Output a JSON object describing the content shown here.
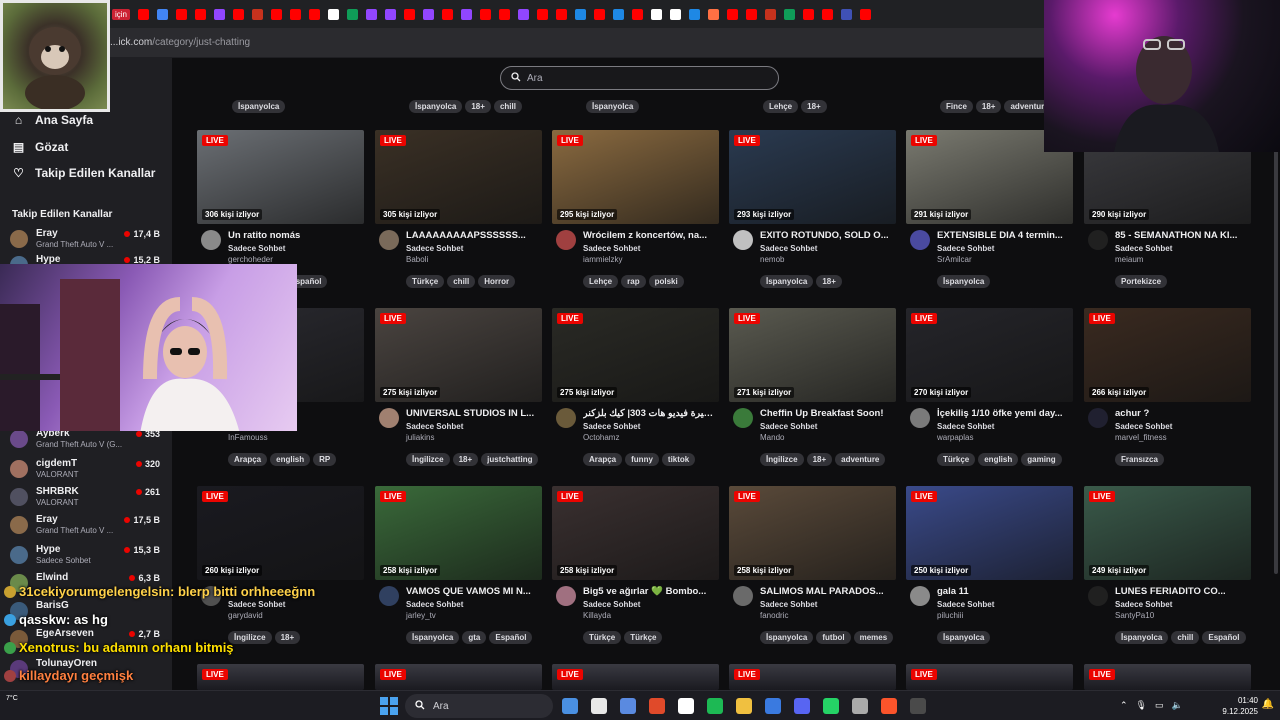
{
  "browser": {
    "url_prefix": "...ick.com",
    "url_path": "/category/just-chatting",
    "bookmark_label": "için",
    "bookmark_colors": [
      "#ff0000",
      "#4285f4",
      "#ff0000",
      "#ff0000",
      "#9146ff",
      "#ff0000",
      "#c7321d",
      "#ff0000",
      "#ff0000",
      "#ff0000",
      "#ffffff",
      "#0f9d58",
      "#9146ff",
      "#9146ff",
      "#ff0000",
      "#9146ff",
      "#ff0000",
      "#9146ff",
      "#ff0000",
      "#ff0000",
      "#9146ff",
      "#ff0000",
      "#ff0000",
      "#1e88e5",
      "#ff0000",
      "#1e88e5",
      "#ff0000",
      "#ffffff",
      "#ffffff",
      "#1e88e5",
      "#ff7043",
      "#ff0000",
      "#ff0000",
      "#c7321d",
      "#0f9d58",
      "#ff0000",
      "#ff0000",
      "#3f51b5",
      "#ff0000"
    ]
  },
  "sidebar": {
    "nav": [
      {
        "label": "Ana Sayfa",
        "icon": "home-icon",
        "glyph": "⌂"
      },
      {
        "label": "Gözat",
        "icon": "browse-icon",
        "glyph": "▤"
      },
      {
        "label": "Takip Edilen Kanallar",
        "icon": "heart-icon",
        "glyph": "♡"
      }
    ],
    "followed_heading": "Takip Edilen Kanallar",
    "channels": [
      {
        "name": "Eray",
        "game": "Grand Theft Auto V ...",
        "viewers": "17,4 B",
        "color": "#8a6a4a"
      },
      {
        "name": "Hype",
        "game": "",
        "viewers": "15,2 B",
        "color": "#4a6a8a"
      },
      {
        "name": "Ayberk",
        "game": "Grand Theft Auto V (G...",
        "viewers": "353",
        "color": "#6a4a8a"
      },
      {
        "name": "cigdemT",
        "game": "VALORANT",
        "viewers": "320",
        "color": "#a07060"
      },
      {
        "name": "SHRBRK",
        "game": "VALORANT",
        "viewers": "261",
        "color": "#505060"
      },
      {
        "name": "Eray",
        "game": "Grand Theft Auto V ...",
        "viewers": "17,5 B",
        "color": "#8a6a4a"
      },
      {
        "name": "Hype",
        "game": "Sadece Sohbet",
        "viewers": "15,3 B",
        "color": "#4a6a8a"
      },
      {
        "name": "Elwind",
        "game": "",
        "viewers": "6,3 B",
        "color": "#6a8a4a"
      },
      {
        "name": "BarisG",
        "game": "",
        "viewers": "",
        "color": "#3a5a7a"
      },
      {
        "name": "EgeArseven",
        "game": "",
        "viewers": "2,7 B",
        "color": "#7a5a3a"
      },
      {
        "name": "TolunayOren",
        "game": "",
        "viewers": "",
        "color": "#5a3a7a"
      }
    ]
  },
  "search": {
    "placeholder": "Ara"
  },
  "top_tag_rows": [
    [
      "İspanyolca"
    ],
    [
      "İspanyolca",
      "18+",
      "chill"
    ],
    [
      "İspanyolca"
    ],
    [
      "Lehçe",
      "18+"
    ],
    [
      "Fince",
      "18+",
      "adventure"
    ]
  ],
  "cards": [
    {
      "viewers": "306 kişi izliyor",
      "title": "Un ratito nomás",
      "category": "Sadece Sohbet",
      "channel": "gerchoheder",
      "tags": [
        "İspanyolca",
        "Español"
      ],
      "thumb": "#6b6f74",
      "avatar": "#8a8a8a"
    },
    {
      "viewers": "305 kişi izliyor",
      "title": "LAAAAAAAAAPSSSSSS...",
      "category": "Sadece Sohbet",
      "channel": "Baboli",
      "tags": [
        "Türkçe",
        "chill",
        "Horror"
      ],
      "thumb": "#3a3025",
      "avatar": "#7a6a5a"
    },
    {
      "viewers": "295 kişi izliyor",
      "title": "Wrócilem z koncertów, na...",
      "category": "Sadece Sohbet",
      "channel": "iammielzky",
      "tags": [
        "Lehçe",
        "rap",
        "polski"
      ],
      "thumb": "#8a6a40",
      "avatar": "#a04040"
    },
    {
      "viewers": "293 kişi izliyor",
      "title": "EXITO ROTUNDO, SOLD O...",
      "category": "Sadece Sohbet",
      "channel": "nemob",
      "tags": [
        "İspanyolca",
        "18+"
      ],
      "thumb": "#2a3a50",
      "avatar": "#c0c0c0"
    },
    {
      "viewers": "291 kişi izliyor",
      "title": "EXTENSIBLE DIA 4 termin...",
      "category": "Sadece Sohbet",
      "channel": "SrAmilcar",
      "tags": [
        "İspanyolca"
      ],
      "thumb": "#7a7a70",
      "avatar": "#4a4aa0"
    },
    {
      "viewers": "290 kişi izliyor",
      "title": "85 - SEMANATHON NA KI...",
      "category": "Sadece Sohbet",
      "channel": "meiaum",
      "tags": [
        "Portekizce"
      ],
      "thumb": "#3a3a3e",
      "avatar": "#202020"
    },
    {
      "viewers": "",
      "title": "Zero Noise.",
      "category": "",
      "channel": "InFamouss",
      "tags": [
        "Arapça",
        "english",
        "RP"
      ],
      "thumb": "#2a2a30",
      "avatar": "#404040"
    },
    {
      "viewers": "275 kişi izliyor",
      "title": "UNIVERSAL STUDIOS IN L...",
      "category": "Sadece Sohbet",
      "channel": "juliakins",
      "tags": [
        "İngilizce",
        "18+",
        "justchatting"
      ],
      "thumb": "#4a4440",
      "avatar": "#a08070"
    },
    {
      "viewers": "275 kişi izliyor",
      "title": "سيرة فيديو هات 303| كيك بلزكنر 🔮",
      "category": "Sadece Sohbet",
      "channel": "Octohamz",
      "tags": [
        "Arapça",
        "funny",
        "tiktok"
      ],
      "thumb": "#2a2a25",
      "avatar": "#6a5a3a"
    },
    {
      "viewers": "271 kişi izliyor",
      "title": "Cheffin Up Breakfast Soon!",
      "category": "Sadece Sohbet",
      "channel": "Mando",
      "tags": [
        "İngilizce",
        "18+",
        "adventure"
      ],
      "thumb": "#5a5a50",
      "avatar": "#3a7a3a"
    },
    {
      "viewers": "270 kişi izliyor",
      "title": "İçekiliş 1/10 öfke yemi day...",
      "category": "Sadece Sohbet",
      "channel": "warpaplas",
      "tags": [
        "Türkçe",
        "english",
        "gaming"
      ],
      "thumb": "#25252a",
      "avatar": "#7a7a7a"
    },
    {
      "viewers": "266 kişi izliyor",
      "title": "achur ?",
      "category": "Sadece Sohbet",
      "channel": "marvel_fitness",
      "tags": [
        "Fransızca"
      ],
      "thumb": "#3a2a20",
      "avatar": "#202030"
    },
    {
      "viewers": "260 kişi izliyor",
      "title": "",
      "category": "Sadece Sohbet",
      "channel": "garydavid",
      "tags": [
        "İngilizce",
        "18+"
      ],
      "thumb": "#1a1a20",
      "avatar": "#505050"
    },
    {
      "viewers": "258 kişi izliyor",
      "title": "VAMOS QUE VAMOS MI N...",
      "category": "Sadece Sohbet",
      "channel": "jarley_tv",
      "tags": [
        "İspanyolca",
        "gta",
        "Español"
      ],
      "thumb": "#3a6a3a",
      "avatar": "#304060"
    },
    {
      "viewers": "258 kişi izliyor",
      "title": "Big5 ve ağırlar 💚 Bombo...",
      "category": "Sadece Sohbet",
      "channel": "Killayda",
      "tags": [
        "Türkçe",
        "Türkçe"
      ],
      "thumb": "#3a3030",
      "avatar": "#a07080"
    },
    {
      "viewers": "258 kişi izliyor",
      "title": "SALIMOS MAL PARADOS...",
      "category": "Sadece Sohbet",
      "channel": "fanodric",
      "tags": [
        "İspanyolca",
        "futbol",
        "memes"
      ],
      "thumb": "#5a4a3a",
      "avatar": "#6a6a6a"
    },
    {
      "viewers": "250 kişi izliyor",
      "title": "gala 11",
      "category": "Sadece Sohbet",
      "channel": "piluchiii",
      "tags": [
        "İspanyolca"
      ],
      "thumb": "#3a4a8a",
      "avatar": "#8a8a8a"
    },
    {
      "viewers": "249 kişi izliyor",
      "title": "LUNES FERIADITO CO...",
      "category": "Sadece Sohbet",
      "channel": "SantyPa10",
      "tags": [
        "İspanyolca",
        "chill",
        "Español"
      ],
      "thumb": "#3a5a4a",
      "avatar": "#202020"
    }
  ],
  "chat": [
    {
      "user": "31cekiyorumgelengelsin",
      "text": "blerp bitti orhheeeğnn",
      "color": "#ffd24a",
      "badge": "#c8a030"
    },
    {
      "user": "qasskw",
      "text": "as hg",
      "color": "#ffffff",
      "badge": "#3aa0e0"
    },
    {
      "user": "Xenotrus",
      "text": "bu adamın orhanı bitmiş",
      "color": "#ffe000",
      "badge": "#3aa04a"
    },
    {
      "user": "",
      "text": "killaydayı geçmişk",
      "color": "#ff8040",
      "badge": "#a04040"
    },
    {
      "user": "ateeTT",
      "text": "deeeğ",
      "color": "#ff4040",
      "badge": "#a04040"
    }
  ],
  "taskbar": {
    "search_placeholder": "Ara",
    "time": "01:40",
    "date": "9.12.2025",
    "weather": "7°C",
    "app_colors": [
      "#4a90e2",
      "#e8e8e8",
      "#5a8ae0",
      "#e04a2a",
      "#ffffff",
      "#1db954",
      "#f0c040",
      "#3a7ae0",
      "#5865f2",
      "#25d366",
      "#aaaaaa",
      "#fb542b",
      "#4a4a4a"
    ]
  }
}
